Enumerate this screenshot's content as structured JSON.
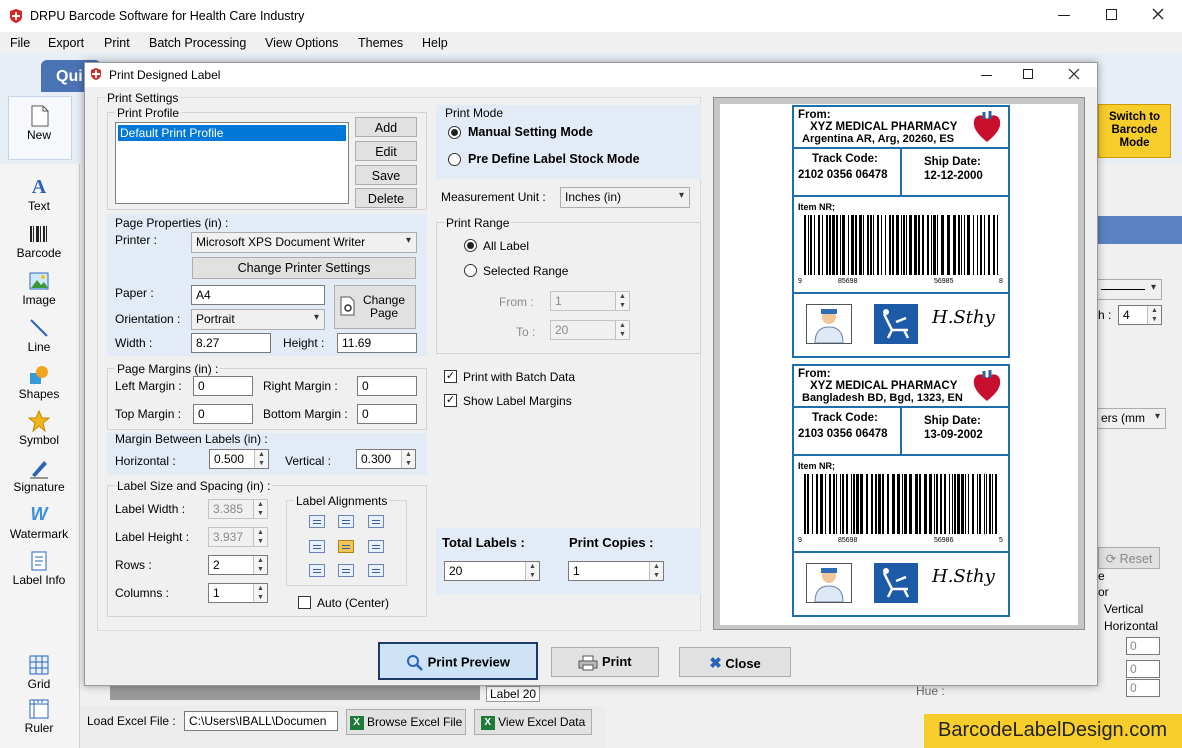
{
  "app": {
    "title": "DRPU Barcode Software for Health Care Industry"
  },
  "menu": [
    "File",
    "Export",
    "Print",
    "Batch Processing",
    "View Options",
    "Themes",
    "Help"
  ],
  "ribbon": {
    "quick_tab": "Qui",
    "new_label": "New",
    "switch_button": "Switch to Barcode Mode"
  },
  "toolbar": [
    "Text",
    "Barcode",
    "Image",
    "Line",
    "Shapes",
    "Symbol",
    "Signature",
    "Watermark",
    "Label Info",
    "Grid",
    "Ruler"
  ],
  "right_panel": {
    "stepper_value": "4",
    "stepper_label": "h :",
    "units_tail": "ers (mm",
    "reset": "Reset",
    "vertical": "Vertical",
    "horizontal": "Horizontal",
    "fields": [
      "0",
      "0",
      "0"
    ],
    "hue_label": "Hue :",
    "e_label": "e",
    "or_label": "or"
  },
  "bottom": {
    "label_tab": "Label 20",
    "load_excel_label": "Load Excel File :",
    "excel_path": "C:\\Users\\IBALL\\Documen",
    "browse_excel": "Browse Excel File",
    "view_excel": "View Excel Data"
  },
  "watermark": "BarcodeLabelDesign.com",
  "dialog": {
    "title": "Print Designed Label",
    "print_settings": "Print Settings",
    "print_profile": {
      "heading": "Print Profile",
      "items": [
        "Default Print Profile"
      ],
      "buttons": [
        "Add",
        "Edit",
        "Save",
        "Delete"
      ]
    },
    "page_properties": {
      "heading": "Page Properties (in) :",
      "printer_label": "Printer :",
      "printer_value": "Microsoft XPS Document Writer",
      "change_printer": "Change Printer Settings",
      "paper_label": "Paper :",
      "paper_value": "A4",
      "change_page": "Change Page",
      "orientation_label": "Orientation :",
      "orientation_value": "Portrait",
      "width_label": "Width :",
      "width_value": "8.27",
      "height_label": "Height :",
      "height_value": "11.69"
    },
    "page_margins": {
      "heading": "Page Margins (in) :",
      "left_label": "Left Margin :",
      "left_value": "0",
      "right_label": "Right Margin :",
      "right_value": "0",
      "top_label": "Top Margin :",
      "top_value": "0",
      "bottom_label": "Bottom Margin :",
      "bottom_value": "0"
    },
    "margin_between": {
      "heading": "Margin Between Labels (in) :",
      "horizontal_label": "Horizontal :",
      "horizontal_value": "0.500",
      "vertical_label": "Vertical :",
      "vertical_value": "0.300"
    },
    "label_size": {
      "heading": "Label Size and Spacing (in) :",
      "width_label": "Label Width :",
      "width_value": "3.385",
      "height_label": "Label Height :",
      "height_value": "3.937",
      "rows_label": "Rows :",
      "rows_value": "2",
      "columns_label": "Columns :",
      "columns_value": "1",
      "alignments_heading": "Label Alignments",
      "auto_center": "Auto (Center)"
    },
    "print_mode": {
      "heading": "Print Mode",
      "manual": "Manual Setting Mode",
      "predefine": "Pre Define Label Stock Mode",
      "selected": "manual"
    },
    "measurement": {
      "label": "Measurement Unit :",
      "value": "Inches (in)"
    },
    "print_range": {
      "heading": "Print Range",
      "all": "All Label",
      "selected_range": "Selected Range",
      "from_label": "From :",
      "from_value": "1",
      "to_label": "To :",
      "to_value": "20"
    },
    "options": {
      "batch": "Print with Batch Data",
      "batch_checked": true,
      "margins": "Show Label Margins",
      "margins_checked": true
    },
    "totals": {
      "total_label": "Total Labels :",
      "total_value": "20",
      "copies_label": "Print Copies :",
      "copies_value": "1"
    },
    "buttons": {
      "preview": "Print Preview",
      "print": "Print",
      "close": "Close"
    },
    "labels": [
      {
        "from": "From:",
        "company": "XYZ MEDICAL PHARMACY",
        "address": "Argentina AR, Arg, 20260, ES",
        "track_label": "Track Code:",
        "track_value": "2102  0356  06478",
        "ship_label": "Ship Date:",
        "ship_value": "12-12-2000",
        "item": "Item NR;",
        "bc_left": "9",
        "bc_mid1": "85698",
        "bc_mid2": "56985",
        "bc_right": "8"
      },
      {
        "from": "From:",
        "company": "XYZ MEDICAL PHARMACY",
        "address": "Bangladesh BD, Bgd, 1323, EN",
        "track_label": "Track Code:",
        "track_value": "2103  0356  06478",
        "ship_label": "Ship Date:",
        "ship_value": "13-09-2002",
        "item": "Item NR;",
        "bc_left": "9",
        "bc_mid1": "85698",
        "bc_mid2": "56986",
        "bc_right": "5"
      }
    ],
    "signature_text": "H.Sthy"
  }
}
